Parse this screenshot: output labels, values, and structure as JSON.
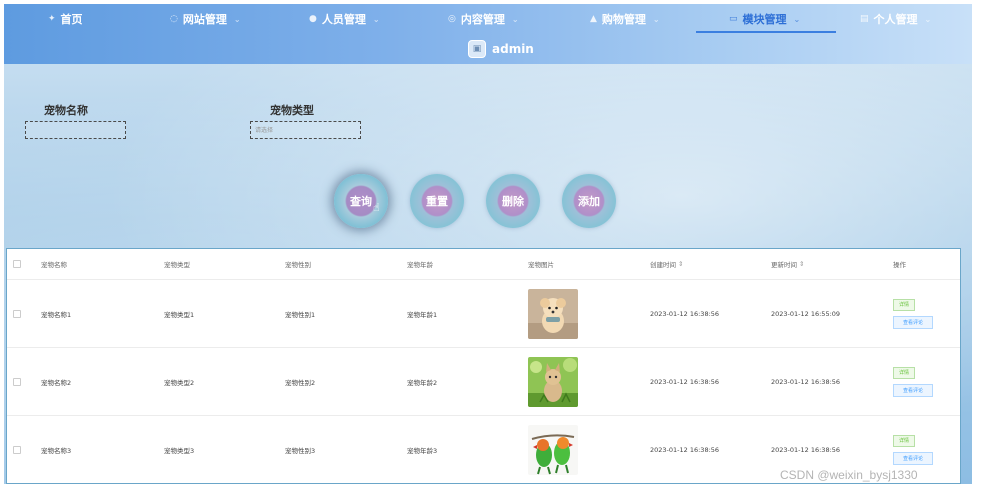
{
  "nav": {
    "items": [
      {
        "label": "首页",
        "icon": "home-icon",
        "has_menu": false
      },
      {
        "label": "网站管理",
        "icon": "globe-icon",
        "has_menu": true
      },
      {
        "label": "人员管理",
        "icon": "user-icon",
        "has_menu": true
      },
      {
        "label": "内容管理",
        "icon": "content-icon",
        "has_menu": true
      },
      {
        "label": "购物管理",
        "icon": "lock-icon",
        "has_menu": true
      },
      {
        "label": "模块管理",
        "icon": "module-icon",
        "has_menu": true,
        "active": true
      },
      {
        "label": "个人管理",
        "icon": "document-icon",
        "has_menu": true
      }
    ],
    "user": "admin"
  },
  "search": {
    "name_label": "宠物名称",
    "name_value": "",
    "type_label": "宠物类型",
    "type_placeholder": "请选择"
  },
  "actions": {
    "query": "查询",
    "reset": "重置",
    "delete": "删除",
    "add": "添加"
  },
  "table": {
    "headers": {
      "name": "宠物名称",
      "type": "宠物类型",
      "gender": "宠物性别",
      "age": "宠物年龄",
      "photo": "宠物图片",
      "created": "创建时间",
      "updated": "更新时间",
      "ops": "操作"
    },
    "rows": [
      {
        "name": "宠物名称1",
        "type": "宠物类型1",
        "gender": "宠物性别1",
        "age": "宠物年龄1",
        "photo": "dog",
        "created": "2023-01-12 16:38:56",
        "updated": "2023-01-12 16:55:09"
      },
      {
        "name": "宠物名称2",
        "type": "宠物类型2",
        "gender": "宠物性别2",
        "age": "宠物年龄2",
        "photo": "cat",
        "created": "2023-01-12 16:38:56",
        "updated": "2023-01-12 16:38:56"
      },
      {
        "name": "宠物名称3",
        "type": "宠物类型3",
        "gender": "宠物性别3",
        "age": "宠物年龄3",
        "photo": "parrots",
        "created": "2023-01-12 16:38:56",
        "updated": "2023-01-12 16:38:56"
      }
    ],
    "detail_label": "详情",
    "review_label": "查看评论"
  },
  "watermark": "CSDN @weixin_bysj1330"
}
